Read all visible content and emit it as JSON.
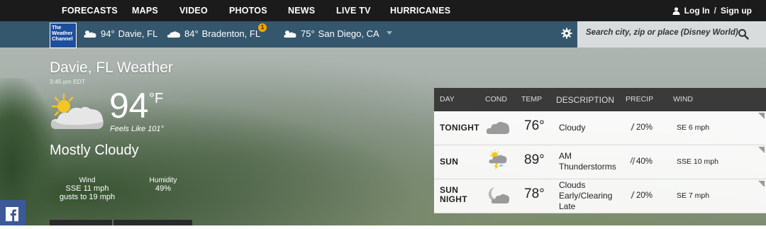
{
  "nav": {
    "items": [
      "FORECASTS",
      "MAPS",
      "VIDEO",
      "PHOTOS",
      "NEWS",
      "LIVE TV",
      "HURRICANES"
    ],
    "login": "Log In",
    "separator": "/",
    "signup": "Sign up"
  },
  "logo": {
    "text_lines": [
      "The",
      "Weather",
      "Channel"
    ]
  },
  "recent_locations": [
    {
      "temp": "94°",
      "name": "Davie, FL",
      "icon": "cloud-icon"
    },
    {
      "temp": "84°",
      "name": "Bradenton, FL",
      "icon": "cloud-icon",
      "alert_count": "1"
    },
    {
      "temp": "75°",
      "name": "San Diego, CA",
      "icon": "cloud-icon"
    }
  ],
  "search": {
    "placeholder": "Search city, zip or place (Disney World)"
  },
  "current": {
    "city_title": "Davie, FL Weather",
    "time": "3:45 pm EDT",
    "temp": "94",
    "unit": "°F",
    "feels_like": "Feels Like 101°",
    "phrase": "Mostly Cloudy",
    "wind_label": "Wind",
    "wind_value": "SSE 11 mph",
    "wind_gusts": "gusts to 19 mph",
    "humidity_label": "Humidity",
    "humidity_value": "49%"
  },
  "forecast": {
    "headers": {
      "day": "DAY",
      "cond": "COND",
      "temp": "TEMP",
      "description": "DESCRIPTION",
      "precip": "PRECIP",
      "wind": "WIND"
    },
    "rows": [
      {
        "day_line1": "TONIGHT",
        "day_line2": "",
        "icon": "cloud-icon",
        "temp": "76°",
        "desc_line1": "Cloudy",
        "desc_line2": "",
        "desc_line3": "",
        "precip": "20%",
        "wind": "SE 6 mph"
      },
      {
        "day_line1": "SUN",
        "day_line2": "",
        "icon": "thunderstorm-icon",
        "temp": "89°",
        "desc_line1": "AM",
        "desc_line2": "Thunderstorms",
        "desc_line3": "",
        "precip": "40%",
        "wind": "SSE 10 mph"
      },
      {
        "day_line1": "SUN",
        "day_line2": "NIGHT",
        "icon": "moon-cloud-icon",
        "temp": "78°",
        "desc_line1": "Clouds",
        "desc_line2": "Early/Clearing",
        "desc_line3": "Late",
        "precip": "20%",
        "wind": "SE 7 mph"
      }
    ]
  },
  "colors": {
    "top_nav": "#1b1b1b",
    "location_bar": "#2e5169",
    "search_bg": "#d9dcdc",
    "forecast_header": "#3a3a3a",
    "alert_badge": "#f0a500",
    "facebook": "#3b5998"
  }
}
